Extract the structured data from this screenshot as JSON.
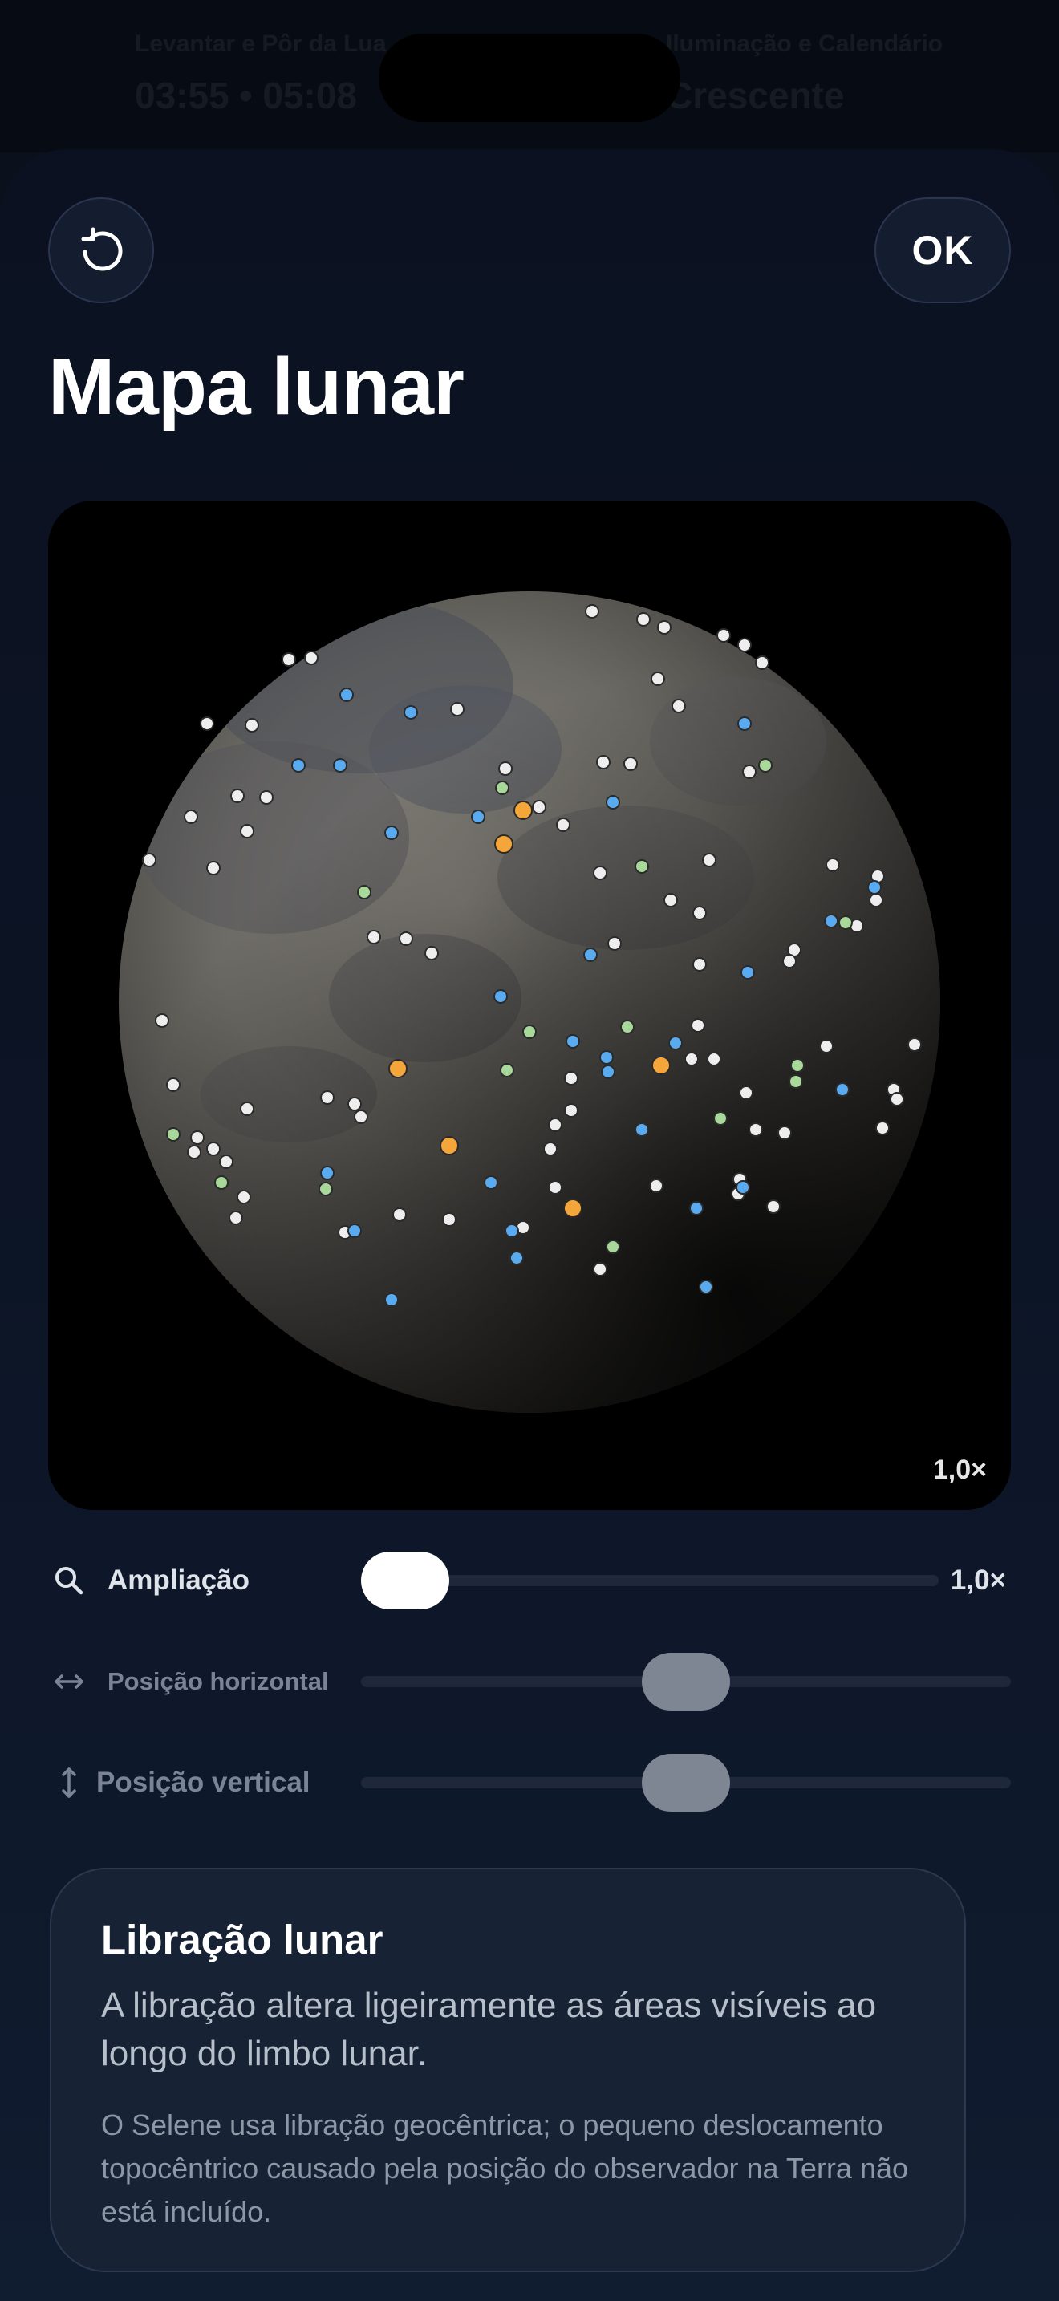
{
  "background": {
    "label_left": "Levantar e Pôr da Lua",
    "value_left": "03:55 • 05:08",
    "label_right": "Iluminação e Calendário",
    "value_right": "Crescente"
  },
  "header": {
    "reset_icon": "counterclockwise-reset-icon",
    "ok_label": "OK",
    "title": "Mapa lunar"
  },
  "map": {
    "zoom_badge": "1,0×",
    "marker_colors": {
      "white": "#eeeeee",
      "blue": "#5aaaf0",
      "green": "#a8d89a",
      "orange": "#f5a63a"
    }
  },
  "controls": {
    "zoom": {
      "icon": "magnifier-icon",
      "label": "Ampliação",
      "value": "1,0×",
      "level": 0.0
    },
    "horizontal": {
      "icon": "horizontal-arrows-icon",
      "label": "Posição horizontal",
      "level": 0.5
    },
    "vertical": {
      "icon": "vertical-arrows-icon",
      "label": "Posição vertical",
      "level": 0.5
    }
  },
  "info": {
    "title": "Libração lunar",
    "body": "A libração altera ligeiramente as áreas visíveis ao longo do limbo lunar.",
    "note": "O Selene usa libração geocêntrica; o pequeno deslocamento topocêntrico causado pela posição do observador na Terra não está incluído."
  },
  "colors": {
    "accent_thumb": "#ffffff",
    "disabled_thumb": "#7e8694",
    "track": "#1f283b",
    "card_bg": "#172234"
  }
}
